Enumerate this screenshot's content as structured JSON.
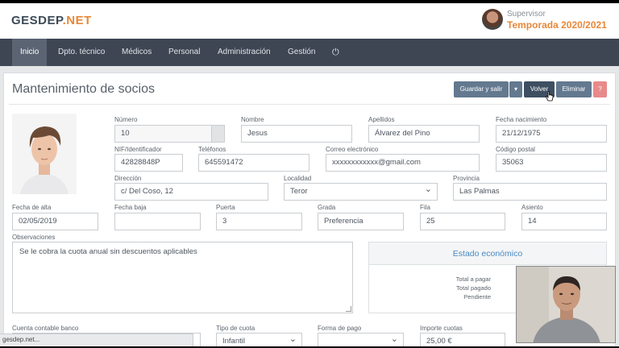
{
  "brand": {
    "logo_main": "GESDEP",
    "logo_dot": ".",
    "logo_net": "NET"
  },
  "user": {
    "role": "Supervisor",
    "season": "Temporada 2020/2021"
  },
  "nav": {
    "items": [
      "Inicio",
      "Dpto. técnico",
      "Médicos",
      "Personal",
      "Administración",
      "Gestión"
    ],
    "power_icon": "⏻"
  },
  "page": {
    "title": "Mantenimiento de socios"
  },
  "actions": {
    "save": "Guardar y salir",
    "caret": "▾",
    "back": "Volver",
    "delete": "Eliminar",
    "help": "?"
  },
  "form": {
    "numero": {
      "label": "Número",
      "value": "10"
    },
    "nombre": {
      "label": "Nombre",
      "value": "Jesus"
    },
    "apellidos": {
      "label": "Apellidos",
      "value": "Álvarez del Pino"
    },
    "fecha_nacimiento": {
      "label": "Fecha nacimiento",
      "value": "21/12/1975"
    },
    "nif": {
      "label": "NIF/Identificador",
      "value": "42828848P"
    },
    "telefonos": {
      "label": "Teléfonos",
      "value": "645591472"
    },
    "correo": {
      "label": "Correo electrónico",
      "value": "xxxxxxxxxxxx@gmail.com"
    },
    "codigo_postal": {
      "label": "Código postal",
      "value": "35063"
    },
    "direccion": {
      "label": "Dirección",
      "value": "c/ Del Coso, 12"
    },
    "localidad": {
      "label": "Localidad",
      "value": "Teror"
    },
    "provincia": {
      "label": "Provincia",
      "value": "Las Palmas"
    },
    "fecha_alta": {
      "label": "Fecha de alta",
      "value": "02/05/2019"
    },
    "fecha_baja": {
      "label": "Fecha baja",
      "value": ""
    },
    "puerta": {
      "label": "Puerta",
      "value": "3"
    },
    "grada": {
      "label": "Grada",
      "value": "Preferencia"
    },
    "fila": {
      "label": "Fila",
      "value": "25"
    },
    "asiento": {
      "label": "Asiento",
      "value": "14"
    },
    "observaciones": {
      "label": "Observaciones",
      "value": "Se le cobra la cuota anual sin descuentos aplicables"
    },
    "cuenta_banco": {
      "label": "Cuenta contable banco",
      "value": ""
    },
    "tipo_cuota": {
      "label": "Tipo de cuota",
      "value": "Infantil"
    },
    "forma_pago": {
      "label": "Forma de pago",
      "value": ""
    },
    "importe_cuotas": {
      "label": "Importe cuotas",
      "value": "25,00 €"
    }
  },
  "economico": {
    "title": "Estado económico",
    "total_pagar": "Total a pagar",
    "total_pagado": "Total pagado",
    "pendiente": "Pendiente"
  },
  "status_url": "gesdep.net..."
}
